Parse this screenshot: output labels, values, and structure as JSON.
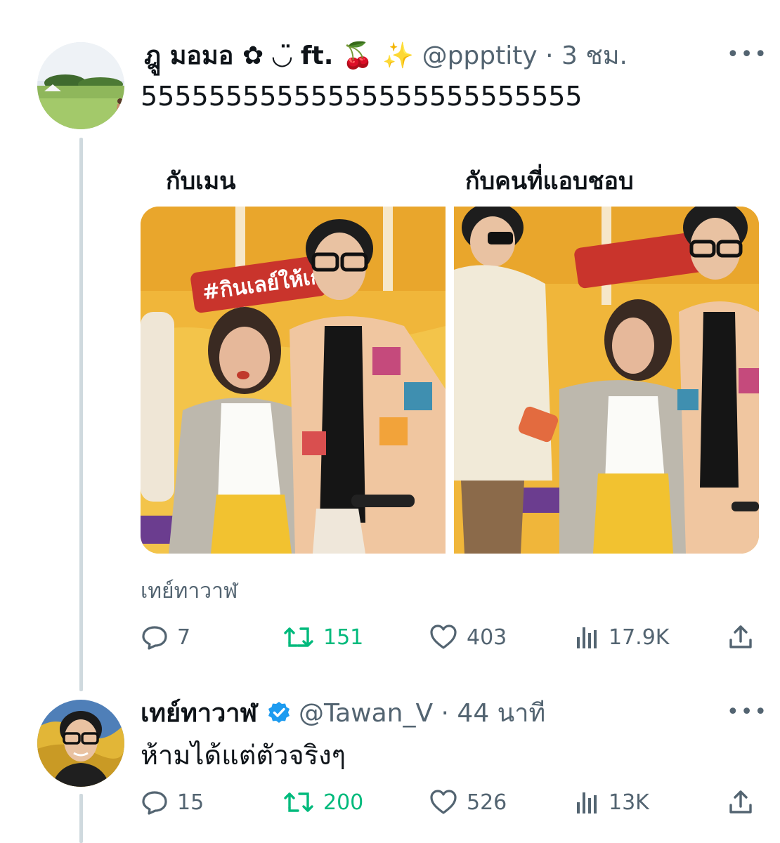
{
  "tweets": [
    {
      "name": "ฎู มอมอ ✿ ◡̈ ft. 🍒 ✨",
      "handle": "@ppptity",
      "time": "· 3 ชม.",
      "more": "•••",
      "text": "55555555555555555555555555",
      "media": {
        "left_caption": "กับเมน",
        "right_caption": "กับคนที่แอบชอบ",
        "banner_text": "#กินเลย์ให้เก",
        "alt": "เทย์ทาวาฬ"
      },
      "stats": {
        "replies": "7",
        "retweets": "151",
        "likes": "403",
        "views": "17.9K"
      }
    },
    {
      "name": "เทย์ทาวาฬ",
      "verified": true,
      "handle": "@Tawan_V",
      "time": "· 44 นาที",
      "more": "•••",
      "text": "ห้ามได้แต่ตัวจริงๆ",
      "stats": {
        "replies": "15",
        "retweets": "200",
        "likes": "526",
        "views": "13K"
      }
    }
  ],
  "colors": {
    "retweet": "#00ba7c",
    "verified": "#1d9bf0",
    "muted": "#536471",
    "thread_line": "#cfd9de"
  }
}
